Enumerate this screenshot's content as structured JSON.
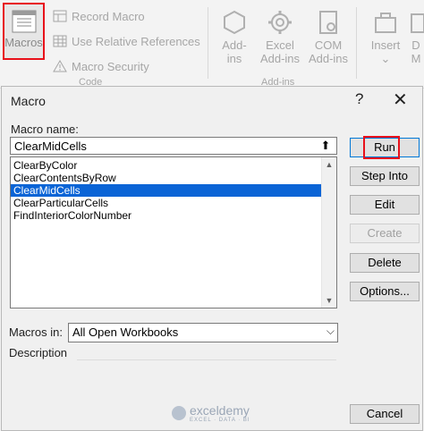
{
  "ribbon": {
    "macros_label": "Macros",
    "record_macro": "Record Macro",
    "use_relative": "Use Relative References",
    "macro_security": "Macro Security",
    "code_group": "Code",
    "addins_label_1": "Add-",
    "addins_label_2": "ins",
    "excel_addins_1": "Excel",
    "excel_addins_2": "Add-ins",
    "com_addins_1": "COM",
    "com_addins_2": "Add-ins",
    "addins_group": "Add-ins",
    "insert_label": "Insert",
    "insert_caret": "⌄",
    "design_label_1": "D",
    "design_label_2": "M"
  },
  "dialog": {
    "title": "Macro",
    "help": "?",
    "close": "✕",
    "macro_name_label": "Macro name:",
    "macro_name_value": "ClearMidCells",
    "upload_icon": "⬆",
    "macros": [
      "ClearByColor",
      "ClearContentsByRow",
      "ClearMidCells",
      "ClearParticularCells",
      "FindInteriorColorNumber"
    ],
    "selected_index": 2,
    "buttons": {
      "run": "Run",
      "step_into": "Step Into",
      "edit": "Edit",
      "create": "Create",
      "delete": "Delete",
      "options": "Options...",
      "cancel": "Cancel"
    },
    "macros_in_label": "Macros in:",
    "macros_in_value": "All Open Workbooks",
    "description_label": "Description"
  },
  "watermark": {
    "brand": "exceldemy",
    "sub": "EXCEL · DATA · BI"
  },
  "colors": {
    "highlight": "#e8101a",
    "selection": "#0a64d6"
  }
}
